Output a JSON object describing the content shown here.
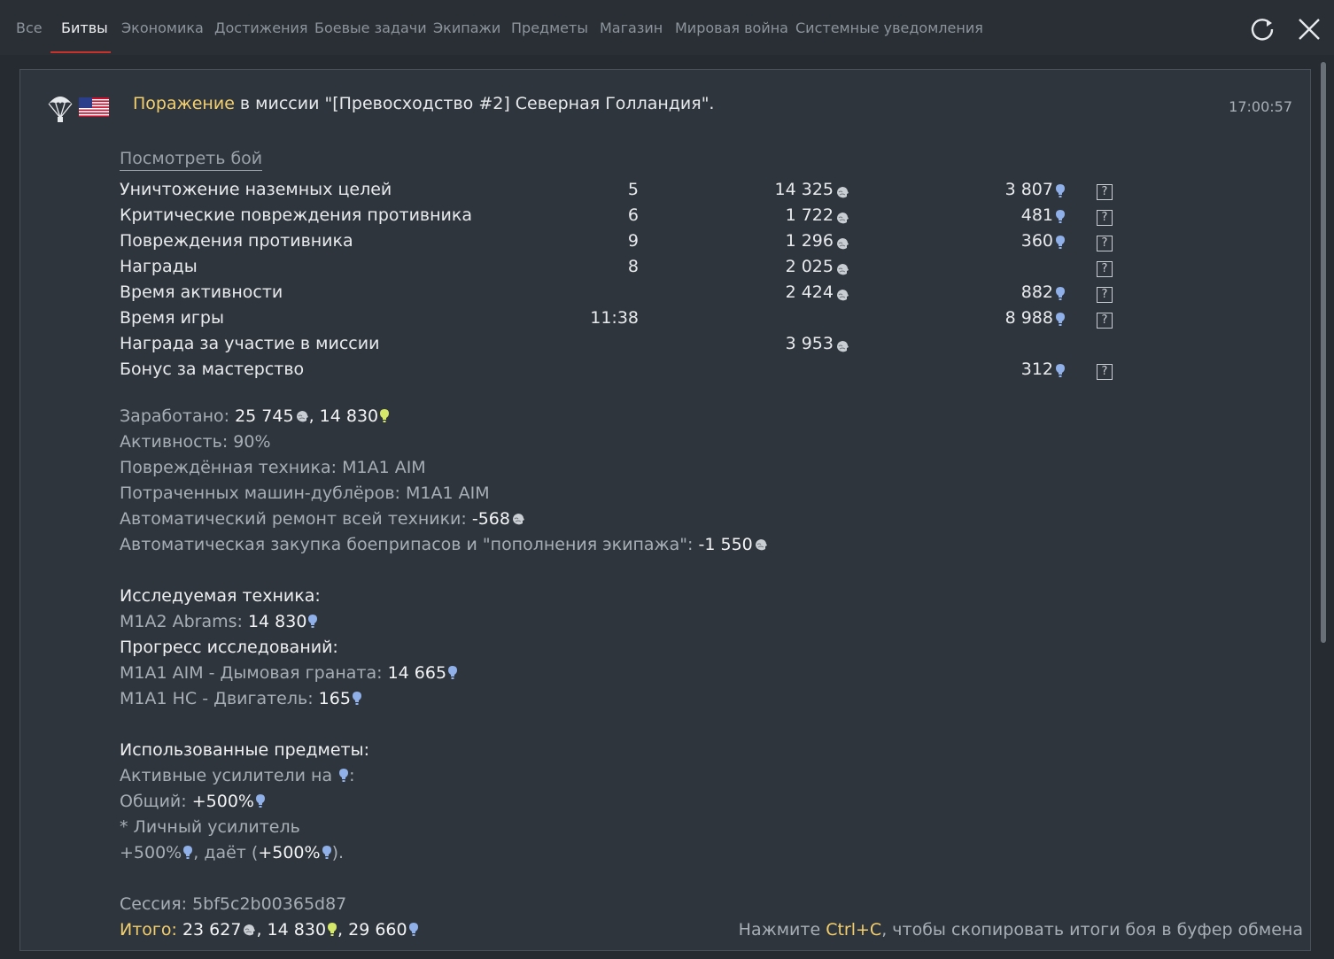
{
  "tabs": [
    "Все",
    "Битвы",
    "Экономика",
    "Достижения",
    "Боевые задачи",
    "Экипажи",
    "Предметы",
    "Магазин",
    "Мировая война",
    "Системные уведомления"
  ],
  "header": {
    "result": "Поражение",
    "mission_text": " в миссии \"[Превосходство #2] Северная Голландия\".",
    "time": "17:00:57"
  },
  "watch_battle": "Посмотреть бой",
  "rows": [
    {
      "label": "Уничтожение наземных целей",
      "count": "5",
      "silver": "14 325",
      "rp": "3 807",
      "help": true
    },
    {
      "label": "Критические повреждения противника",
      "count": "6",
      "silver": "1 722",
      "rp": "481",
      "help": true
    },
    {
      "label": "Повреждения противника",
      "count": "9",
      "silver": "1 296",
      "rp": "360",
      "help": true
    },
    {
      "label": "Награды",
      "count": "8",
      "silver": "2 025",
      "rp": "",
      "help": true
    },
    {
      "label": "Время активности",
      "count": "",
      "silver": "2 424",
      "rp": "882",
      "help": true
    },
    {
      "label": "Время игры",
      "count": "11:38",
      "silver": "",
      "rp": "8 988",
      "help": true
    },
    {
      "label": "Награда за участие в миссии",
      "count": "",
      "silver": "3 953",
      "rp": "",
      "help": false
    },
    {
      "label": "Бонус за мастерство",
      "count": "",
      "silver": "",
      "rp": "312",
      "help": true
    }
  ],
  "summary": {
    "earned_label": "Заработано: ",
    "earned_silver": "25 745",
    "earned_sep": ", ",
    "earned_rp": "14 830",
    "activity": "Активность: 90%",
    "damaged_label": "Повреждённая техника: ",
    "damaged_value": "M1A1 AIM",
    "backups_label": "Потраченных машин-дублёров: ",
    "backups_value": "M1A1 AIM",
    "repair_label": "Автоматический ремонт всей техники: ",
    "repair_value": "-568",
    "ammo_label": "Автоматическая закупка боеприпасов и \"пополнения экипажа\": ",
    "ammo_value": "-1 550"
  },
  "research": {
    "title": "Исследуемая техника:",
    "vehicle_label": "M1A2 Abrams: ",
    "vehicle_value": "14 830",
    "progress_title": "Прогресс исследований:",
    "item1_label": "M1A1 AIM - Дымовая граната: ",
    "item1_value": "14 665",
    "item2_label": "M1A1 HC - Двигатель: ",
    "item2_value": "165"
  },
  "items": {
    "title": "Использованные предметы:",
    "boosters_label": "Активные усилители на ",
    "boosters_suffix": ":",
    "total_label": "Общий: ",
    "total_value": "+500%",
    "personal": "* Личный усилитель",
    "personal_value": "+500%",
    "gives": ", даёт (",
    "gives_value": "+500%",
    "gives_end": ")."
  },
  "footer": {
    "session": "Сессия: 5bf5c2b00365d87",
    "total_label": "Итого:",
    "total_silver": " 23 627",
    "total_sep1": ", ",
    "total_gold_rp": "14 830",
    "total_sep2": ", ",
    "total_rp": "29 660",
    "hint_pre": "Нажмите ",
    "hint_key": "Ctrl+C",
    "hint_post": ", чтобы скопировать итоги боя в буфер обмена"
  },
  "colors": {
    "result": "#f3cf6e",
    "rp_icon": "#8fb0e8",
    "gold_rp_icon": "#d6e86a",
    "tab_accent": "#c7322a"
  },
  "icons": [
    "refresh-icon",
    "close-icon",
    "parachute-icon",
    "usa-flag-icon",
    "silver-lion-icon",
    "research-bulb-icon",
    "help-icon"
  ]
}
